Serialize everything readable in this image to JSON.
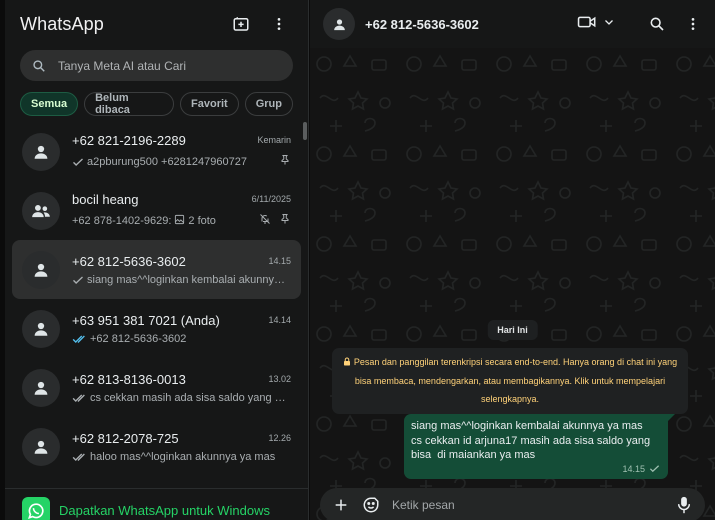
{
  "sidebar": {
    "title": "WhatsApp",
    "search_placeholder": "Tanya Meta AI atau Cari",
    "filters": [
      {
        "label": "Semua",
        "active": true
      },
      {
        "label": "Belum dibaca",
        "active": false
      },
      {
        "label": "Favorit",
        "active": false
      },
      {
        "label": "Grup",
        "active": false
      }
    ],
    "chats": [
      {
        "name": "+62 821-2196-2289",
        "time": "Kemarin",
        "preview": "a2pburung500 +6281247960727",
        "tick": "single",
        "pinned": true,
        "muted": false,
        "group": false
      },
      {
        "name": "bocil heang",
        "time": "6/11/2025",
        "preview_prefix": "+62 878-1402-9629:",
        "preview": "2 foto",
        "tick": "none",
        "pinned": true,
        "muted": true,
        "group": true
      },
      {
        "name": "+62 812-5636-3602",
        "time": "14.15",
        "preview": "siang mas^^loginkan kembalai akunnya ya mas",
        "tick": "single",
        "pinned": false,
        "muted": false,
        "group": false,
        "selected": true
      },
      {
        "name": "+63 951 381 7021 (Anda)",
        "time": "14.14",
        "preview": "+62 812-5636-3602",
        "tick": "read",
        "pinned": false,
        "muted": false,
        "group": false
      },
      {
        "name": "+62 813-8136-0013",
        "time": "13.02",
        "preview": "cs cekkan masih ada sisa saldo yang bisa di maiankan",
        "tick": "double",
        "pinned": false,
        "muted": false,
        "group": false
      },
      {
        "name": "+62 812-2078-725",
        "time": "12.26",
        "preview": "haloo mas^^loginkan akunnya ya mas",
        "tick": "double",
        "pinned": false,
        "muted": false,
        "group": false
      }
    ],
    "promo": "Dapatkan WhatsApp untuk Windows"
  },
  "conversation": {
    "name": "+62 812-5636-3602",
    "date_label": "Hari Ini",
    "encryption_notice": "Pesan dan panggilan terenkripsi secara end-to-end. Hanya orang di chat ini yang bisa membaca, mendengarkan, atau membagikannya. Klik untuk mempelajari selengkapnya.",
    "message": {
      "text": "siang mas^^loginkan kembalai akunnya ya mas\ncs cekkan id arjuna17 masih ada sisa saldo yang bisa  di maiankan ya mas",
      "time": "14.15"
    },
    "composer_placeholder": "Ketik pesan"
  },
  "colors": {
    "accent": "#25d366",
    "outgoing_bubble": "#144d37",
    "encryption_text": "#ffd279",
    "read_tick": "#53bdeb"
  }
}
